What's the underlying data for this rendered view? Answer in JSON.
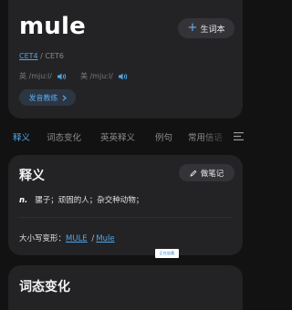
{
  "word_card": {
    "word": "mule",
    "add_button_label": "生词本",
    "level_primary": "CET4",
    "level_separator": " / ",
    "level_secondary": "CET6",
    "pron_uk": "英 /mjuːl/",
    "pron_us": "美 /mjuːl/",
    "teach_button_label": "发音教练"
  },
  "tabs": [
    {
      "label": "释义",
      "active": true
    },
    {
      "label": "词态变化",
      "active": false
    },
    {
      "label": "英英释义",
      "active": false
    },
    {
      "label": "例句",
      "active": false
    },
    {
      "label": "常用信语",
      "active": false
    }
  ],
  "definition": {
    "title": "释义",
    "note_button_label": "做笔记",
    "pos": "n.",
    "meaning": "骡子；顽固的人；杂交种动物；",
    "case_label": "大小写变形：",
    "case_forms": [
      "MULE",
      "Mule"
    ],
    "case_separator": " /"
  },
  "tiny_tag": "正在加载",
  "inflections": {
    "title": "词态变化"
  },
  "colors": {
    "accent": "#4ea8ea",
    "card": "#232325",
    "background": "#121212"
  },
  "icons": {
    "add": "plus-icon",
    "speaker": "speaker-icon",
    "arrow": "chevron-right-icon",
    "note": "pencil-icon",
    "menu": "menu-icon"
  }
}
